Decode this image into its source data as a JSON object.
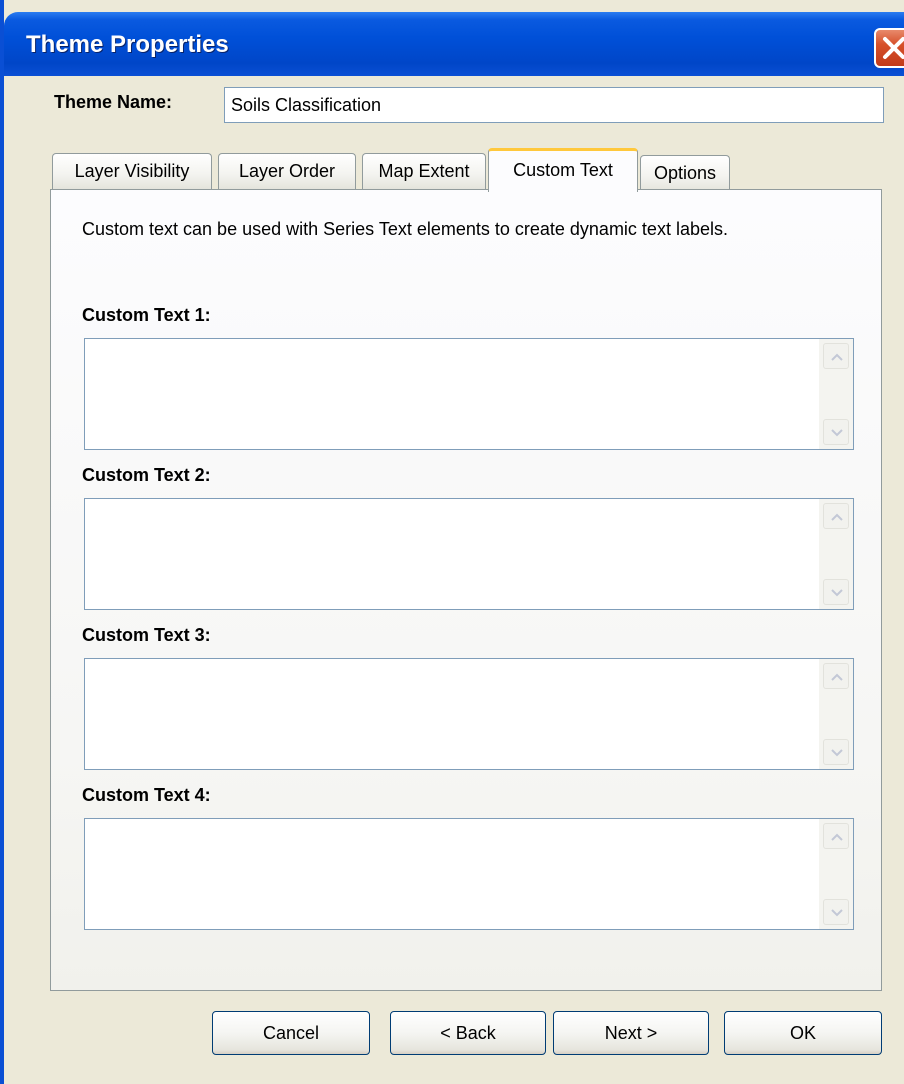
{
  "window": {
    "title": "Theme Properties"
  },
  "theme_name": {
    "label": "Theme Name:",
    "value": "Soils Classification"
  },
  "tabs": [
    {
      "label": "Layer Visibility",
      "active": false
    },
    {
      "label": "Layer Order",
      "active": false
    },
    {
      "label": "Map Extent",
      "active": false
    },
    {
      "label": "Custom Text",
      "active": true
    },
    {
      "label": "Options",
      "active": false
    }
  ],
  "custom_text_panel": {
    "description": "Custom text can be used with Series Text elements to create dynamic text labels.",
    "fields": [
      {
        "label": "Custom Text 1:",
        "value": ""
      },
      {
        "label": "Custom Text 2:",
        "value": ""
      },
      {
        "label": "Custom Text 3:",
        "value": ""
      },
      {
        "label": "Custom Text 4:",
        "value": ""
      }
    ]
  },
  "buttons": {
    "cancel": "Cancel",
    "back": "< Back",
    "next": "Next >",
    "ok": "OK"
  },
  "icons": {
    "close": "close-icon",
    "scroll_up": "chevron-up-icon",
    "scroll_down": "chevron-down-icon"
  },
  "colors": {
    "titlebar": "#0050d8",
    "active_tab_accent": "#ffc83c",
    "close_button": "#d6512b"
  }
}
